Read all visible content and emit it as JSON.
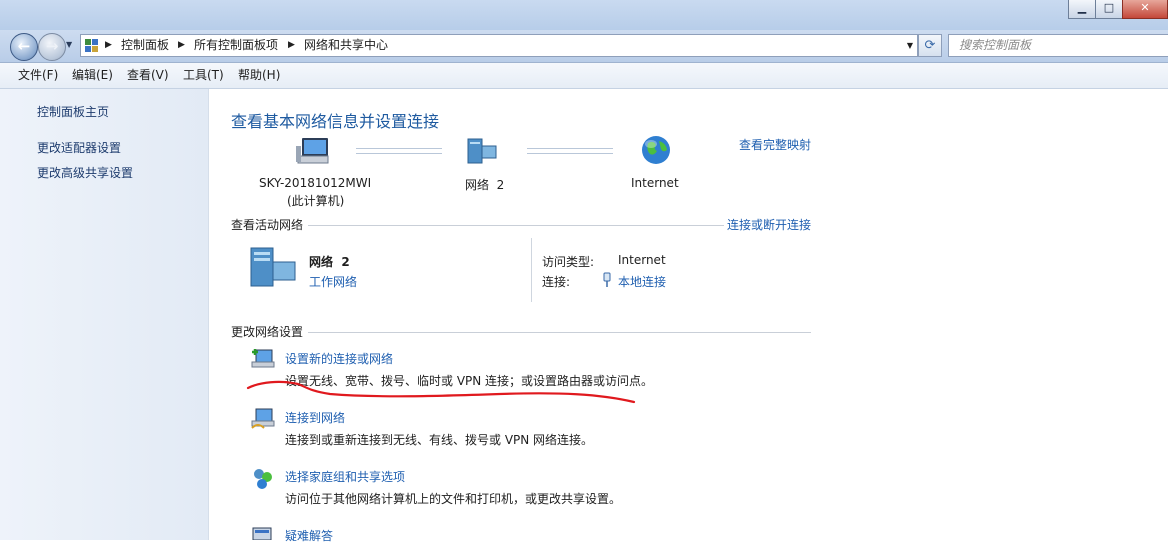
{
  "window": {
    "minimize_icon": "minimize-icon",
    "maximize_icon": "maximize-icon",
    "close_icon": "close-icon"
  },
  "address_bar": {
    "crumbs": [
      "控制面板",
      "所有控制面板项",
      "网络和共享中心"
    ],
    "search_placeholder": "搜索控制面板"
  },
  "menu": [
    "文件(F)",
    "编辑(E)",
    "查看(V)",
    "工具(T)",
    "帮助(H)"
  ],
  "sidebar": {
    "items": [
      {
        "label": "控制面板主页"
      },
      {
        "label": "更改适配器设置"
      },
      {
        "label": "更改高级共享设置"
      }
    ]
  },
  "main": {
    "title": "查看基本网络信息并设置连接",
    "full_map_link": "查看完整映射",
    "map": {
      "computer_name": "SKY-20181012MWI",
      "computer_sub": "(此计算机)",
      "network_name": "网络  2",
      "internet": "Internet"
    },
    "active_networks": {
      "heading": "查看活动网络",
      "connect_link": "连接或断开连接",
      "network_name": "网络  2",
      "network_type": "工作网络",
      "access_type_label": "访问类型:",
      "access_type_value": "Internet",
      "connection_label": "连接:",
      "connection_value": "本地连接"
    },
    "change_settings": {
      "heading": "更改网络设置",
      "tasks": [
        {
          "title": "设置新的连接或网络",
          "desc": "设置无线、宽带、拨号、临时或 VPN 连接；或设置路由器或访问点。",
          "icon": "new-connection-icon"
        },
        {
          "title": "连接到网络",
          "desc": "连接到或重新连接到无线、有线、拨号或 VPN 网络连接。",
          "icon": "connect-network-icon"
        },
        {
          "title": "选择家庭组和共享选项",
          "desc": "访问位于其他网络计算机上的文件和打印机，或更改共享设置。",
          "icon": "homegroup-icon"
        },
        {
          "title": "疑难解答",
          "desc": "",
          "icon": "troubleshoot-icon"
        }
      ]
    }
  },
  "annotation": {
    "color": "#e0191e"
  }
}
